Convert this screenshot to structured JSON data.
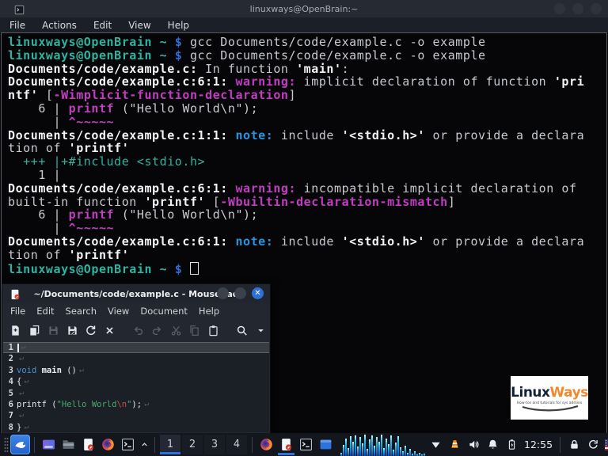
{
  "terminal": {
    "title": "linuxways@OpenBrain:~",
    "menu": [
      "File",
      "Actions",
      "Edit",
      "View",
      "Help"
    ],
    "lines": [
      {
        "segments": [
          {
            "t": "linuxways@OpenBrain",
            "c": "p"
          },
          {
            "t": " ~ ",
            "c": "p"
          },
          {
            "t": "$ ",
            "c": "d"
          },
          {
            "t": "gcc Documents/code/example.c -o example",
            "c": "t"
          }
        ]
      },
      {
        "segments": [
          {
            "t": "linuxways@OpenBrain",
            "c": "p"
          },
          {
            "t": " ~ ",
            "c": "p"
          },
          {
            "t": "$ ",
            "c": "d"
          },
          {
            "t": "gcc Documents/code/example.c -o example",
            "c": "t"
          }
        ]
      },
      {
        "segments": [
          {
            "t": "Documents/code/example.c:",
            "c": "w"
          },
          {
            "t": " In function ",
            "c": "t"
          },
          {
            "t": "'main'",
            "c": "w"
          },
          {
            "t": ":",
            "c": "t"
          }
        ]
      },
      {
        "segments": [
          {
            "t": "Documents/code/example.c:6:1:",
            "c": "w"
          },
          {
            "t": " ",
            "c": "t"
          },
          {
            "t": "warning:",
            "c": "m"
          },
          {
            "t": " implicit declaration of function ",
            "c": "t"
          },
          {
            "t": "'pri",
            "c": "w"
          }
        ]
      },
      {
        "segments": [
          {
            "t": "ntf'",
            "c": "w"
          },
          {
            "t": " [",
            "c": "t"
          },
          {
            "t": "-Wimplicit-function-declaration",
            "c": "m"
          },
          {
            "t": "]",
            "c": "t"
          }
        ]
      },
      {
        "segments": [
          {
            "t": "    6 | ",
            "c": "t"
          },
          {
            "t": "printf",
            "c": "m"
          },
          {
            "t": " (\"Hello World\\n\");",
            "c": "t"
          }
        ]
      },
      {
        "segments": [
          {
            "t": "      | ",
            "c": "t"
          },
          {
            "t": "^~~~~~",
            "c": "m"
          }
        ]
      },
      {
        "segments": [
          {
            "t": "Documents/code/example.c:1:1:",
            "c": "w"
          },
          {
            "t": " ",
            "c": "t"
          },
          {
            "t": "note:",
            "c": "n"
          },
          {
            "t": " include ",
            "c": "t"
          },
          {
            "t": "'<stdio.h>'",
            "c": "w"
          },
          {
            "t": " or provide a declara",
            "c": "t"
          }
        ]
      },
      {
        "segments": [
          {
            "t": "tion of ",
            "c": "t"
          },
          {
            "t": "'printf'",
            "c": "w"
          }
        ]
      },
      {
        "segments": [
          {
            "t": "  +++ |+#include <stdio.h>",
            "c": "g"
          }
        ]
      },
      {
        "segments": [
          {
            "t": "    1 | ",
            "c": "t"
          }
        ]
      },
      {
        "segments": [
          {
            "t": "Documents/code/example.c:6:1:",
            "c": "w"
          },
          {
            "t": " ",
            "c": "t"
          },
          {
            "t": "warning:",
            "c": "m"
          },
          {
            "t": " incompatible implicit declaration of",
            "c": "t"
          }
        ]
      },
      {
        "segments": [
          {
            "t": "built-in function ",
            "c": "t"
          },
          {
            "t": "'printf'",
            "c": "w"
          },
          {
            "t": " [",
            "c": "t"
          },
          {
            "t": "-Wbuiltin-declaration-mismatch",
            "c": "m"
          },
          {
            "t": "]",
            "c": "t"
          }
        ]
      },
      {
        "segments": [
          {
            "t": "    6 | ",
            "c": "t"
          },
          {
            "t": "printf",
            "c": "m"
          },
          {
            "t": " (\"Hello World\\n\");",
            "c": "t"
          }
        ]
      },
      {
        "segments": [
          {
            "t": "      | ",
            "c": "t"
          },
          {
            "t": "^~~~~~",
            "c": "m"
          }
        ]
      },
      {
        "segments": [
          {
            "t": "Documents/code/example.c:6:1:",
            "c": "w"
          },
          {
            "t": " ",
            "c": "t"
          },
          {
            "t": "note:",
            "c": "n"
          },
          {
            "t": " include ",
            "c": "t"
          },
          {
            "t": "'<stdio.h>'",
            "c": "w"
          },
          {
            "t": " or provide a declara",
            "c": "t"
          }
        ]
      },
      {
        "segments": [
          {
            "t": "tion of ",
            "c": "t"
          },
          {
            "t": "'printf'",
            "c": "w"
          }
        ]
      },
      {
        "segments": [
          {
            "t": "linuxways@OpenBrain",
            "c": "p"
          },
          {
            "t": " ~ ",
            "c": "p"
          },
          {
            "t": "$ ",
            "c": "d"
          },
          {
            "cursor": true
          }
        ]
      }
    ]
  },
  "editor": {
    "window_title": "~/Documents/code/example.c - Mousepad",
    "menu": [
      "File",
      "Edit",
      "Search",
      "View",
      "Document",
      "Help"
    ],
    "close_glyph": "✕",
    "toolbar": [
      {
        "name": "new-file",
        "enabled": true
      },
      {
        "name": "open",
        "enabled": true
      },
      {
        "name": "save",
        "enabled": false
      },
      {
        "name": "save-as",
        "enabled": true
      },
      {
        "name": "reload",
        "enabled": true
      },
      {
        "name": "close-tab",
        "enabled": true
      },
      {
        "name": "undo",
        "enabled": false,
        "gap": true
      },
      {
        "name": "redo",
        "enabled": false
      },
      {
        "name": "cut",
        "enabled": false
      },
      {
        "name": "copy",
        "enabled": false
      },
      {
        "name": "paste",
        "enabled": true
      },
      {
        "name": "find",
        "enabled": true,
        "gap": true
      },
      {
        "name": "menu-caret",
        "enabled": true
      }
    ],
    "newline_symbol": "↵",
    "lines": [
      {
        "n": "1",
        "current": true,
        "cursor": true,
        "segs": []
      },
      {
        "n": "2",
        "segs": []
      },
      {
        "n": "3",
        "segs": [
          {
            "t": "void ",
            "c": "kw"
          },
          {
            "t": "main",
            "c": "b"
          },
          {
            "t": " ()",
            "c": "fg"
          }
        ]
      },
      {
        "n": "4",
        "segs": [
          {
            "t": "{",
            "c": "fg"
          }
        ]
      },
      {
        "n": "5",
        "segs": []
      },
      {
        "n": "6",
        "segs": [
          {
            "t": "printf (",
            "c": "fg"
          },
          {
            "t": "\"Hello World",
            "c": "str"
          },
          {
            "t": "\\n",
            "c": "esc"
          },
          {
            "t": "\"",
            "c": "str"
          },
          {
            "t": ");",
            "c": "fg"
          }
        ]
      },
      {
        "n": "7",
        "segs": []
      },
      {
        "n": "8",
        "segs": [
          {
            "t": "}",
            "c": "fg"
          }
        ]
      }
    ]
  },
  "taskbar": {
    "launcher": "kali-menu",
    "quicklaunch": [
      "show-desktop",
      "file-manager",
      "mousepad",
      "firefox",
      "terminal"
    ],
    "workspaces": [
      {
        "label": "1",
        "active": true
      },
      {
        "label": "2",
        "active": false
      },
      {
        "label": "3",
        "active": false
      },
      {
        "label": "4",
        "active": false
      }
    ],
    "tasks": [
      {
        "icon": "firefox",
        "active": false
      },
      {
        "icon": "mousepad",
        "active": true
      },
      {
        "icon": "terminal",
        "active": false
      },
      {
        "icon": "window",
        "active": false
      }
    ],
    "tray_icons": [
      "network",
      "vlc",
      "volume",
      "notifications",
      "battery"
    ],
    "clock": "12:55",
    "session_icons": [
      "lock",
      "logout"
    ],
    "keyboard_layout": "us-flag"
  },
  "logo": {
    "brand_primary": "Linux",
    "brand_secondary": "Ways",
    "tagline": "How-tos and tutorials for sys admins"
  },
  "colors": {
    "accent": "#2e72dd",
    "prompt_teal": "#2fb3a1",
    "dollar_blue": "#2e6fd8",
    "warning_magenta": "#c13ec1",
    "note_blue": "#2795e0"
  }
}
